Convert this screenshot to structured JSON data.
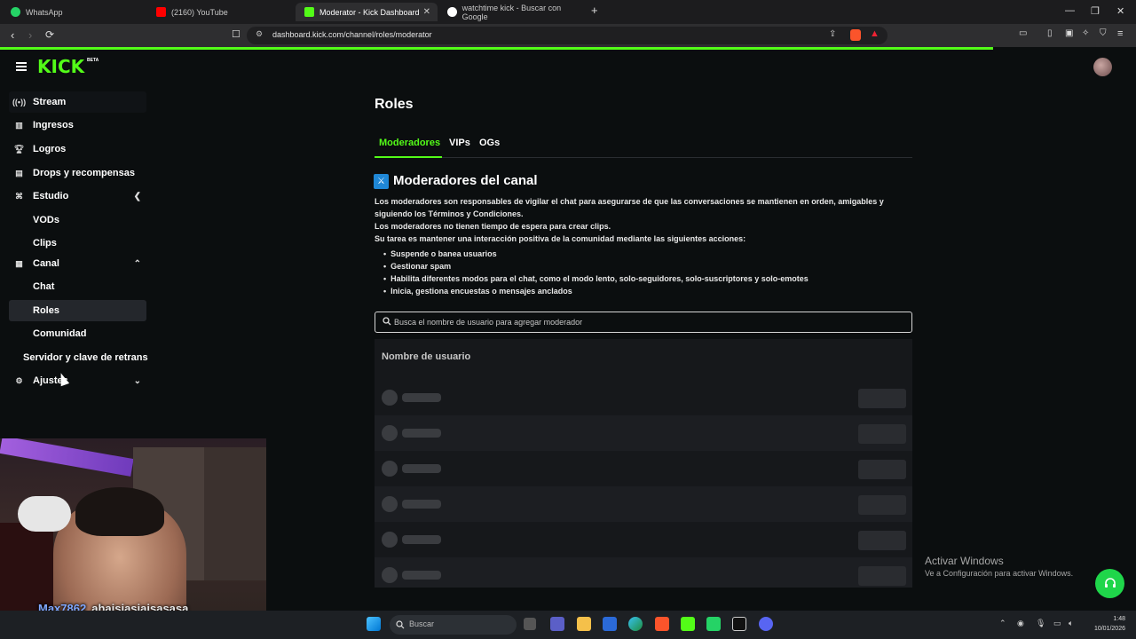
{
  "browser": {
    "tabs": [
      {
        "label": "WhatsApp",
        "color": "#25d366"
      },
      {
        "label": "(2160) YouTube",
        "color": "#ff0000"
      },
      {
        "label": "Moderator - Kick Dashboard",
        "color": "#53fc18"
      },
      {
        "label": "watchtime kick - Buscar con Google",
        "color": "#4285f4"
      }
    ],
    "url": "dashboard.kick.com/channel/roles/moderator"
  },
  "header": {
    "logo": "KICK",
    "logo_badge": "BETA"
  },
  "sidebar": {
    "items": [
      {
        "label": "Stream",
        "icon": "broadcast-icon"
      },
      {
        "label": "Ingresos",
        "icon": "chart-icon"
      },
      {
        "label": "Logros",
        "icon": "trophy-icon"
      },
      {
        "label": "Drops y recompensas",
        "icon": "gift-icon"
      },
      {
        "label": "Estudio",
        "icon": "studio-icon"
      },
      {
        "label": "VODs"
      },
      {
        "label": "Clips"
      },
      {
        "label": "Canal",
        "icon": "channel-icon"
      },
      {
        "label": "Chat"
      },
      {
        "label": "Roles"
      },
      {
        "label": "Comunidad"
      },
      {
        "label": "Servidor y clave de retrans"
      },
      {
        "label": "Ajustes",
        "icon": "gear-icon"
      }
    ]
  },
  "main": {
    "title": "Roles",
    "tabs": [
      "Moderadores",
      "VIPs",
      "OGs"
    ],
    "section_title": "Moderadores del canal",
    "description": [
      "Los moderadores son responsables de vigilar el chat para asegurarse de que las conversaciones se mantienen en orden, amigables y siguiendo los Términos y Condiciones.",
      "Los moderadores no tienen tiempo de espera para crear clips.",
      "Su tarea es mantener una interacción positiva de la comunidad mediante las siguientes acciones:"
    ],
    "bullets": [
      "Suspende o banea usuarios",
      "Gestionar spam",
      "Habilita diferentes modos para el chat, como el modo lento, solo-seguidores, solo-suscriptores y solo-emotes",
      "Inicia, gestiona encuestas o mensajes anclados"
    ],
    "search_placeholder": "Busca el nombre de usuario para agregar moderador",
    "table_header": "Nombre de usuario"
  },
  "watermark": {
    "line1": "Activar Windows",
    "line2": "Ve a Configuración para activar Windows."
  },
  "webcam": {
    "username": "Max7862",
    "message": "ahajsjasjajsasasa"
  },
  "taskbar": {
    "search_placeholder": "Buscar",
    "time": "1:48",
    "date": "10/01/2026"
  },
  "colors": {
    "accent": "#53fc18",
    "background": "#0b0e0f"
  }
}
